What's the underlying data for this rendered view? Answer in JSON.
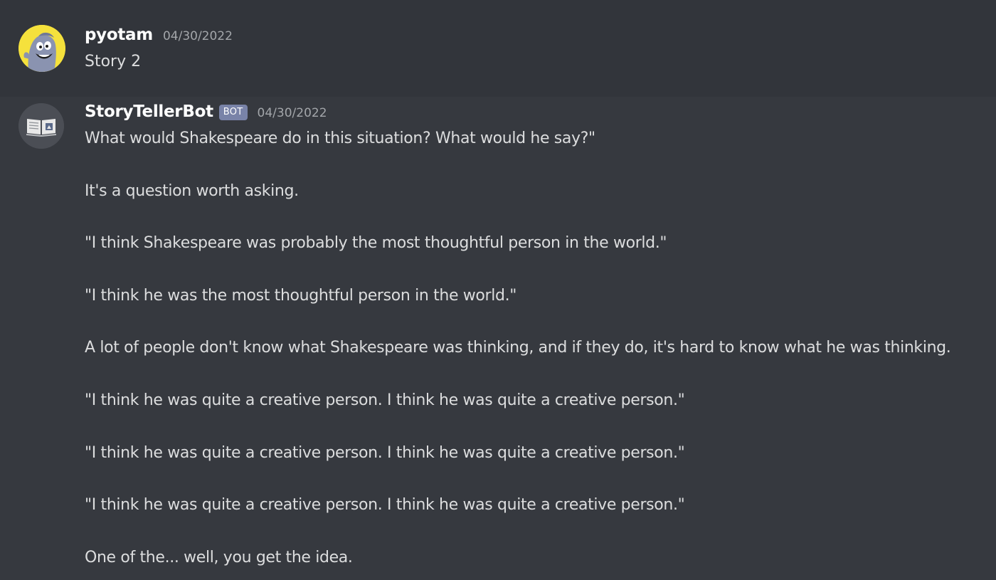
{
  "messages": [
    {
      "username": "pyotam",
      "timestamp": "04/30/2022",
      "content": "Story 2",
      "avatar_icon": "cartoon-character-icon"
    },
    {
      "username": "StoryTellerBot",
      "bot_tag": "BOT",
      "timestamp": "04/30/2022",
      "avatar_icon": "open-book-icon",
      "lines": [
        "What would Shakespeare do in this situation? What would he say?\"",
        "It's a question worth asking.",
        "\"I think Shakespeare was probably the most thoughtful person in the world.\"",
        "\"I think he was the most thoughtful person in the world.\"",
        "A lot of people don't know what Shakespeare was thinking, and if they do, it's hard to know what he was thinking.",
        "\"I think he was quite a creative person. I think he was quite a creative person.\"",
        "\"I think he was quite a creative person. I think he was quite a creative person.\"",
        "\"I think he was quite a creative person. I think he was quite a creative person.\"",
        "One of the... well, you get the idea."
      ]
    }
  ],
  "colors": {
    "background": "#36393f",
    "hover_background": "#32353b",
    "username": "#ffffff",
    "text": "#dcddde",
    "timestamp": "#a3a6aa",
    "bot_tag": "#7983a8",
    "avatar_user_bg": "#f5e13c"
  }
}
